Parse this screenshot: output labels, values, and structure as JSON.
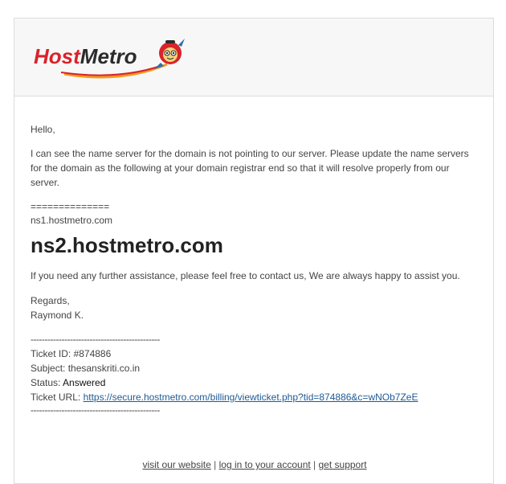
{
  "brand": {
    "name": "HostMetro",
    "colors": {
      "red": "#d8232a",
      "dark": "#2b2b2b",
      "accent_orange": "#f39a1e",
      "link": "#1e5a96"
    }
  },
  "email": {
    "greeting": "Hello,",
    "body": "I can see the name server for the domain is not pointing to our server. Please update the name servers for the domain as the following at your domain registrar end so that it will resolve properly from our server.",
    "separator": "==============",
    "ns1": "ns1.hostmetro.com",
    "ns2": "ns2.hostmetro.com",
    "assist": "If you need any further assistance, please feel free to contact us, We are always happy to assist you.",
    "regards": "Regards,",
    "signer": "Raymond K.",
    "dashes": "----------------------------------------------"
  },
  "ticket": {
    "id_label": "Ticket ID: ",
    "id": "#874886",
    "subject_label": "Subject: ",
    "subject": "thesanskriti.co.in",
    "status_label": "Status: ",
    "status": "Answered",
    "url_label": "Ticket URL: ",
    "url": "https://secure.hostmetro.com/billing/viewticket.php?tid=874886&c=wNOb7ZeE"
  },
  "footer": {
    "visit": "visit our website",
    "login": "log in to your account",
    "support": "get support",
    "sep": " | "
  }
}
